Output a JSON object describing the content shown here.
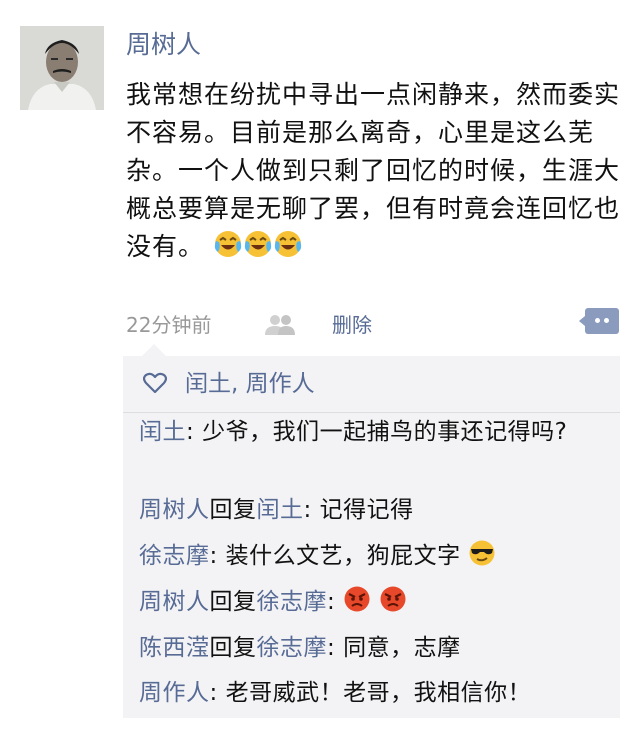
{
  "post": {
    "author": "周树人",
    "text": "我常想在纷扰中寻出一点闲静来，然而委实不容易。目前是那么离奇，心里是这么芜杂。一个人做到只剩了回忆的时候，生涯大概总要算是无聊了罢，但有时竟会连回忆也没有。",
    "emojis": [
      "tears-of-joy",
      "tears-of-joy",
      "tears-of-joy"
    ],
    "timestamp": "22分钟前",
    "delete_label": "删除"
  },
  "likes": {
    "names": "闰土, 周作人"
  },
  "comments": [
    {
      "author": "闰土",
      "text": "少爷，我们一起捕鸟的事还记得吗?"
    },
    {
      "author": "周树人",
      "reply_word": "回复",
      "reply_to": "闰土",
      "text": "记得记得"
    },
    {
      "author": "徐志摩",
      "text": "装什么文艺，狗屁文字",
      "emoji": "sunglasses"
    },
    {
      "author": "周树人",
      "reply_word": "回复",
      "reply_to": "徐志摩",
      "text": "",
      "emoji": "angry-x2"
    },
    {
      "author": "陈西滢",
      "reply_word": "回复",
      "reply_to": "徐志摩",
      "text": "同意，志摩"
    },
    {
      "author": "周作人",
      "text": "老哥威武！老哥，我相信你！"
    }
  ],
  "colors": {
    "name_blue": "#576b95",
    "panel_bg": "#f3f3f5",
    "meta_gray": "#999999"
  }
}
